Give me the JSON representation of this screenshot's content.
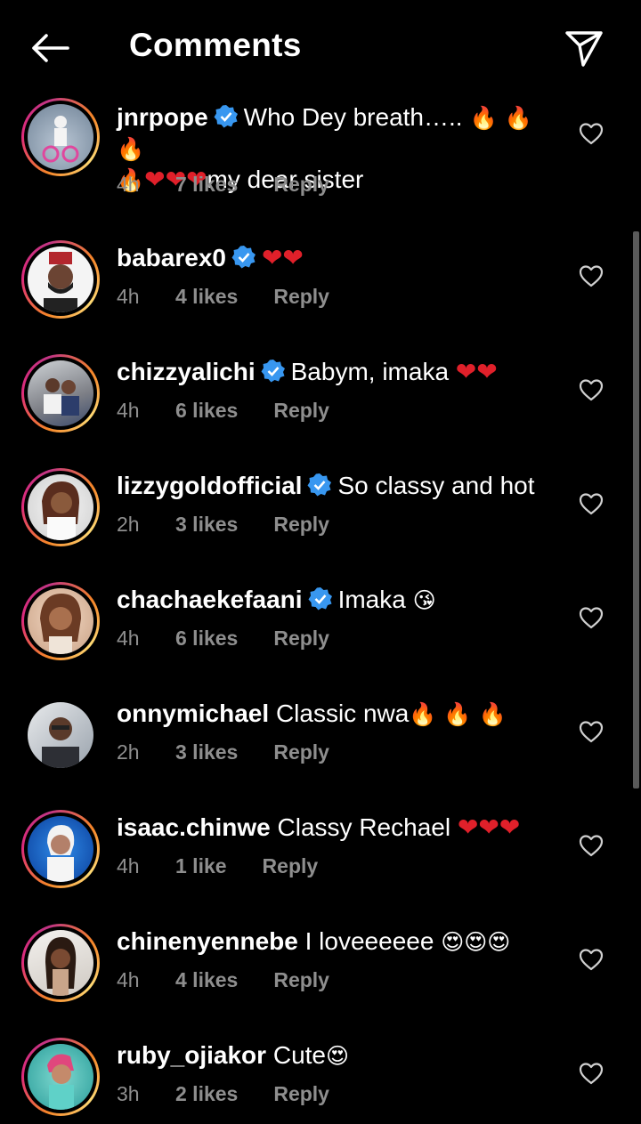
{
  "header": {
    "title": "Comments"
  },
  "comments": [
    {
      "username": "jnrpope",
      "verified": true,
      "text": "Who Dey breath…..",
      "line2_text": "my dear sister",
      "time": "4h",
      "likes": "7 likes",
      "reply": "Reply"
    },
    {
      "username": "babarex0",
      "verified": true,
      "text": "",
      "time": "4h",
      "likes": "4 likes",
      "reply": "Reply"
    },
    {
      "username": "chizzyalichi",
      "verified": true,
      "text": "Babym, imaka ",
      "time": "4h",
      "likes": "6 likes",
      "reply": "Reply"
    },
    {
      "username": "lizzygoldofficial",
      "verified": true,
      "text": "So classy and hot",
      "time": "2h",
      "likes": "3 likes",
      "reply": "Reply"
    },
    {
      "username": "chachaekefaani",
      "verified": true,
      "text": "Imaka ",
      "time": "4h",
      "likes": "6 likes",
      "reply": "Reply"
    },
    {
      "username": "onnymichael",
      "verified": false,
      "text": " Classic nwa",
      "time": "2h",
      "likes": "3 likes",
      "reply": "Reply"
    },
    {
      "username": "isaac.chinwe",
      "verified": false,
      "text": " Classy Rechael ",
      "time": "4h",
      "likes": "1 like",
      "reply": "Reply"
    },
    {
      "username": "chinenyennebe",
      "verified": false,
      "text": " I loveeeeee ",
      "time": "4h",
      "likes": "4 likes",
      "reply": "Reply"
    },
    {
      "username": "ruby_ojiakor",
      "verified": false,
      "text": " Cute",
      "time": "3h",
      "likes": "2 likes",
      "reply": "Reply"
    }
  ],
  "colors": {
    "background": "#000000",
    "meta": "#8e8e8e",
    "verified": "#3897f0",
    "heart": "#e0202a"
  },
  "icons": {
    "back": "arrow-left-icon",
    "share": "paper-plane-icon",
    "like": "heart-outline-icon",
    "verified": "verified-badge-icon"
  }
}
